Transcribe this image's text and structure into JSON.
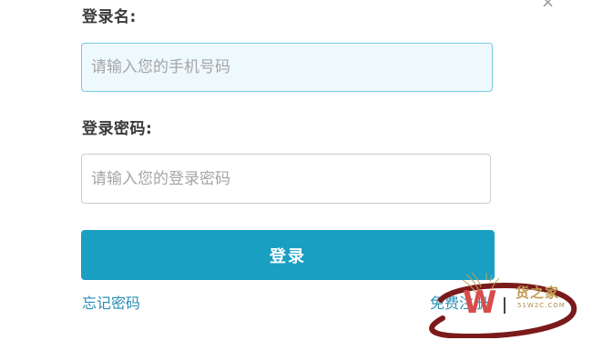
{
  "close": {
    "glyph": "×",
    "icon": "close-icon"
  },
  "username": {
    "label": "登录名:",
    "placeholder": "请输入您的手机号码",
    "value": ""
  },
  "password": {
    "label": "登录密码:",
    "placeholder": "请输入您的登录密码",
    "value": ""
  },
  "login": {
    "label": "登录"
  },
  "links": {
    "forgot": "忘记密码",
    "register": "免费注册"
  },
  "watermark": {
    "text": "货之家",
    "sub": "51W2C.COM"
  },
  "colors": {
    "accent": "#199fc2",
    "link": "#2a8eb5",
    "focused_input_bg": "#eef9fd",
    "annotation_ring": "#7a1a1a",
    "watermark": "#bf9a52"
  }
}
